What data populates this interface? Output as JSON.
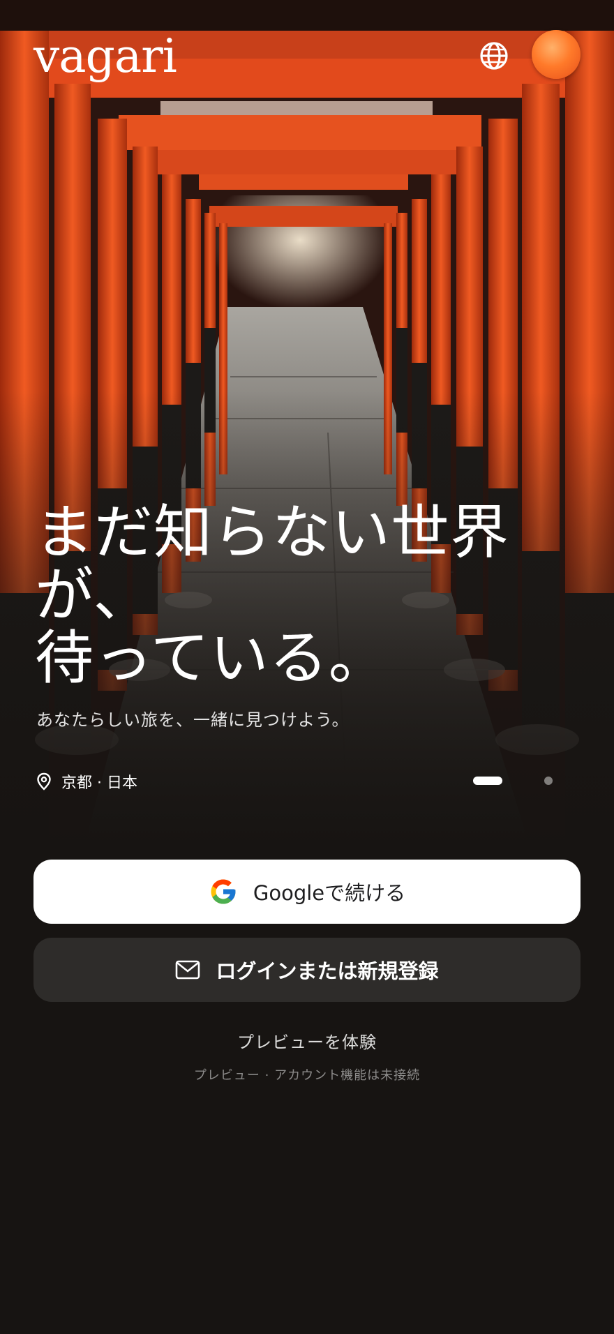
{
  "header": {
    "logo_text": "vagari",
    "globe_icon": "globe-icon",
    "avatar": "avatar"
  },
  "hero": {
    "headline_lines": [
      "まだ知らない世界",
      "が、",
      "待っている。"
    ],
    "subtitle": "あなたらしい旅を、一緒に見つけよう。",
    "location_icon": "location-pin-icon",
    "location_label": "京都 · 日本",
    "carousel": {
      "total": 2,
      "active": 1
    }
  },
  "actions": {
    "google_button_label": "Googleで続ける",
    "google_icon": "google-logo-icon",
    "login_button_label": "ログインまたは新規登録",
    "login_icon": "mail-icon",
    "preview_link_label": "プレビューを体験",
    "footnote": "プレビュー · アカウント機能は未接続"
  },
  "colors": {
    "background": "#171412",
    "torii": "#e24a1c",
    "google_button_bg": "#ffffff",
    "login_button_bg": "#2e2c2a",
    "avatar": "#ff7a2a"
  }
}
